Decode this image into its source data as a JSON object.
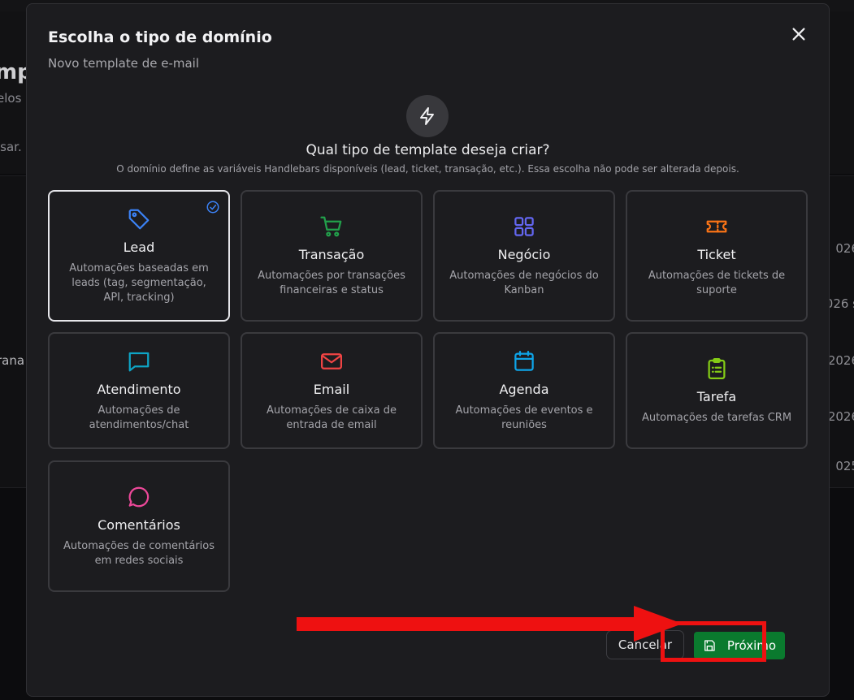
{
  "background": {
    "title_fragment": "mp",
    "subtitle_fragment": "elos",
    "search_fragment": "isar.",
    "row_fragment": "rana",
    "dates": [
      "026",
      "026 s",
      "2026",
      "2026",
      "025 "
    ]
  },
  "modal": {
    "title": "Escolha o tipo de domínio",
    "subtitle": "Novo template de e-mail",
    "question": "Qual tipo de template deseja criar?",
    "note": "O domínio define as variáveis Handlebars disponíveis (lead, ticket, transação, etc.). Essa escolha não pode ser alterada depois.",
    "selected_domain": "Lead",
    "domains": [
      {
        "title": "Lead",
        "desc": "Automações baseadas em leads (tag, segmentação, API, tracking)",
        "icon": "tag-icon",
        "color": "#3b82f6"
      },
      {
        "title": "Transação",
        "desc": "Automações por transações financeiras e status",
        "icon": "shopping-cart-icon",
        "color": "#22a04b"
      },
      {
        "title": "Negócio",
        "desc": "Automações de negócios do Kanban",
        "icon": "grid-icon",
        "color": "#6366f1"
      },
      {
        "title": "Ticket",
        "desc": "Automações de tickets de suporte",
        "icon": "ticket-icon",
        "color": "#f97316"
      },
      {
        "title": "Atendimento",
        "desc": "Automações de atendimentos/chat",
        "icon": "message-square-icon",
        "color": "#0ea5c6"
      },
      {
        "title": "Email",
        "desc": "Automações de caixa de entrada de email",
        "icon": "mail-icon",
        "color": "#ef4444"
      },
      {
        "title": "Agenda",
        "desc": "Automações de eventos e reuniões",
        "icon": "calendar-icon",
        "color": "#0ea5e9"
      },
      {
        "title": "Tarefa",
        "desc": "Automações de tarefas CRM",
        "icon": "clipboard-list-icon",
        "color": "#84cc16"
      },
      {
        "title": "Comentários",
        "desc": "Automações de comentários em redes sociais",
        "icon": "message-circle-icon",
        "color": "#ec4899"
      }
    ],
    "cancel_label": "Cancelar",
    "next_label": "Próximo"
  },
  "colors": {
    "accent_selected": "#3b82f6",
    "primary_button": "#0a7a2e",
    "annotation": "#ee1111"
  }
}
